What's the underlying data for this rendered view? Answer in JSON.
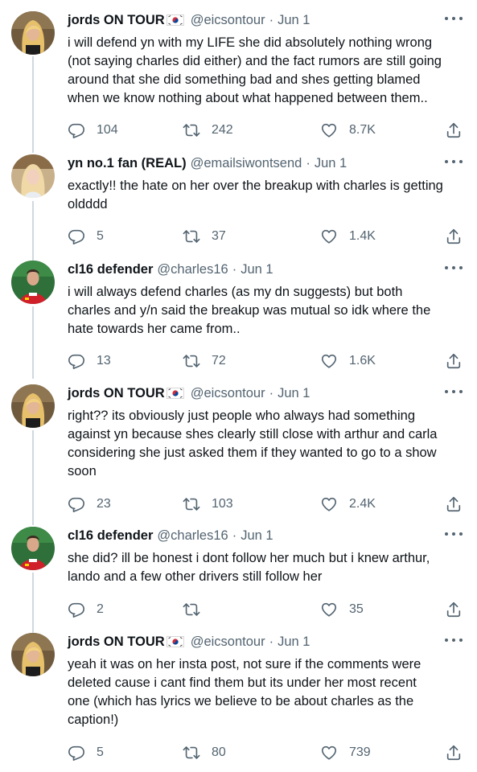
{
  "tweets": [
    {
      "name": "jords ON TOUR",
      "emoji": "korea-flag",
      "handle": "@eicsontour",
      "date": "Jun 1",
      "lines": [
        "i will defend yn with my LIFE she did absolutely nothing wrong",
        "(not saying charles did either) and the fact rumors are still going",
        "around that she did something bad and shes getting blamed",
        "when we know nothing about what happened between them.."
      ],
      "replies": "104",
      "retweets": "242",
      "likes": "8.7K",
      "avatar": "blonde"
    },
    {
      "name": "yn no.1 fan (REAL)",
      "emoji": "",
      "handle": "@emailsiwontsend",
      "date": "Jun 1",
      "lines": [
        "exactly!! the hate on her over the breakup with charles is getting",
        "oldddd"
      ],
      "replies": "5",
      "retweets": "37",
      "likes": "1.4K",
      "avatar": "portrait"
    },
    {
      "name": "cl16 defender",
      "emoji": "",
      "handle": "@charles16",
      "date": "Jun 1",
      "lines": [
        "i will always defend charles (as my dn suggests) but both",
        "charles and y/n said the breakup was mutual so idk where the",
        "hate towards her came from.."
      ],
      "replies": "13",
      "retweets": "72",
      "likes": "1.6K",
      "avatar": "driver"
    },
    {
      "name": "jords ON TOUR",
      "emoji": "korea-flag",
      "handle": "@eicsontour",
      "date": "Jun 1",
      "lines": [
        "right?? its obviously just people who always had something",
        "against yn because shes clearly still close with arthur and carla",
        "considering she just asked them if they wanted to go to a show",
        "soon"
      ],
      "replies": "23",
      "retweets": "103",
      "likes": "2.4K",
      "avatar": "blonde"
    },
    {
      "name": "cl16 defender",
      "emoji": "",
      "handle": "@charles16",
      "date": "Jun 1",
      "lines": [
        "she did? ill be honest i dont follow her much but i knew arthur,",
        "lando and a few other drivers still follow her"
      ],
      "replies": "2",
      "retweets": "",
      "likes": "35",
      "avatar": "driver"
    },
    {
      "name": "jords ON TOUR",
      "emoji": "korea-flag",
      "handle": "@eicsontour",
      "date": "Jun 1",
      "lines": [
        "yeah it was on her insta post, not sure if the comments were",
        "deleted cause i cant find them but its under her most recent",
        "one (which has lyrics we believe to be about charles as the",
        "caption!)"
      ],
      "replies": "5",
      "retweets": "80",
      "likes": "739",
      "avatar": "blonde"
    }
  ],
  "ui": {
    "separator": "·"
  },
  "colors": {
    "secondary": "#536471",
    "text": "#0f1419",
    "thread": "#cfd9de"
  }
}
